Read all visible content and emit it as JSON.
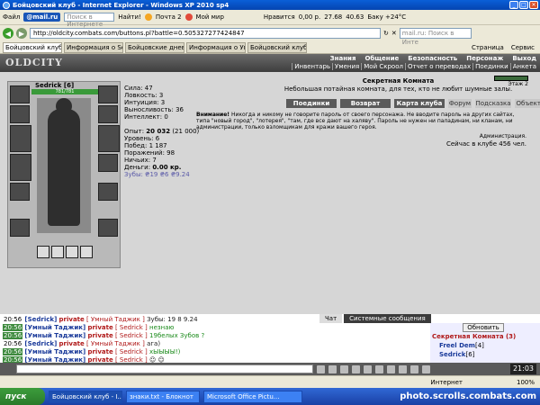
{
  "window": {
    "title": "Бойцовский клуб - Internet Explorer - Windows XP 2010 sp4"
  },
  "menubar": {
    "file": "Файл",
    "mailru": "@mail.ru",
    "search_placeholder": "Поиск в Интернете",
    "find": "Найти!",
    "mail": "Почта 2",
    "moimir": "Мой мир",
    "like": "Нравится",
    "money": "0,00 р.",
    "weather": "Баку +24°C",
    "rate1": "27.68",
    "rate2": "40.63"
  },
  "address": {
    "url": "http://oldcity.combats.com/buttons.pl?battle=0.505327277424847",
    "search_placeholder": "mail.ru: Поиск в Инте"
  },
  "tabs": [
    {
      "label": "Бойцовский клуб"
    },
    {
      "label": "Информация о Sedrick"
    },
    {
      "label": "Бойцовские дневни..."
    },
    {
      "label": "Информация о Умн..."
    },
    {
      "label": "Бойцовский клуб"
    }
  ],
  "ie_toolbar": {
    "page": "Страница",
    "service": "Сервис"
  },
  "game": {
    "logo": "OLDCITY",
    "topnav": [
      "Знания",
      "Общение",
      "Безопасность",
      "Персонаж",
      "Выход"
    ],
    "subnav": [
      "Инвентарь",
      "Умения",
      "Мой Скроол",
      "Отчет о переводах",
      "Поединки",
      "Анкета"
    ],
    "character": {
      "name": "Sedrick",
      "level_tag": "[6]",
      "hp": "781/781"
    },
    "stats": {
      "strength": "Сила: 47",
      "agility": "Ловкость: 3",
      "intuition": "Интуиция: 3",
      "endurance": "Выносливость: 36",
      "intellect": "Интеллект: 0",
      "experience_label": "Опыт:",
      "experience": "20 032",
      "experience_next": "(21 000)",
      "level": "Уровень: 6",
      "wins": "Побед: 1 187",
      "losses": "Поражений: 98",
      "draws": "Ничьих: 7",
      "money_label": "Деньги:",
      "money": "0.00 кр.",
      "teeth": "Зубы: ₴19 ₴6 ₴9.24"
    },
    "room": {
      "title": "Секретная Комната",
      "subtitle": "Небольшая потайная комната, для тех, кто не любит шумные залы.",
      "stage": "Этаж 2",
      "buttons": [
        "Поединки",
        "Возврат",
        "Карта клуба",
        "Форум",
        "Подсказка",
        "Объекты"
      ],
      "warning_label": "Внимание!",
      "warning_text": "Никогда и никому не говорите пароль от своего персонажа. Не вводите пароль на других сайтах, типа \"новый город\", \"лотерея\", \"там, где все дают на халяву\". Пароль не нужен ни паладинам, ни кланам, ни администрации, только взломщикам для кражи вашего героя.",
      "admin": "Администрация.",
      "online": "Сейчас в клубе 456 чел."
    }
  },
  "chat": {
    "tabs": [
      "Чат",
      "Системные сообщения"
    ],
    "lines": [
      {
        "time": "20:56",
        "from": "[Sedrick]",
        "private": "private",
        "to": "[ Умный Таджик ]",
        "msg": "Зубы: 19 8 9.24",
        "msg_style": "k"
      },
      {
        "time": "20:56",
        "from": "[Умный Таджик]",
        "private": "private",
        "to": "[ Sedrick ]",
        "msg": "незнаю",
        "msg_style": "g"
      },
      {
        "time": "20:56",
        "from": "[Умный Таджик]",
        "private": "private",
        "to": "[ Sedrick ]",
        "msg": "19белых Зубов ?",
        "msg_style": "g"
      },
      {
        "time": "20:56",
        "from": "[Sedrick]",
        "private": "private",
        "to": "[ Умный Таджик ]",
        "msg": "ага)",
        "msg_style": "k"
      },
      {
        "time": "20:56",
        "from": "[Умный Таджик]",
        "private": "private",
        "to": "[ Sedrick ]",
        "msg": "хЫЫЫЫ!)",
        "msg_style": "g"
      },
      {
        "time": "20:56",
        "from": "[Умный Таджик]",
        "private": "private",
        "to": "[ Sedrick ]",
        "msg": "☺ ☺",
        "msg_style": "k"
      }
    ],
    "refresh": "Обновить",
    "room_title": "Секретная Комната (3)",
    "users": [
      {
        "name": "Freel Dem",
        "level": "[4]"
      },
      {
        "name": "Sedrick",
        "level": "[6]"
      }
    ],
    "clock": "21:03"
  },
  "status": {
    "zone": "Интернет",
    "zoom": "100%"
  },
  "taskbar": {
    "start": "пуск",
    "tasks": [
      "Бойцовский клуб - I...",
      "знаки.txt - Блокнот",
      "Microsoft Office Pictu..."
    ],
    "watermark": "photo.scrolls.combats.com"
  }
}
